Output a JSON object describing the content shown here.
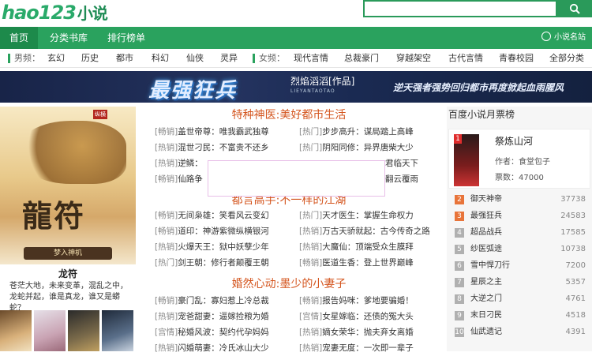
{
  "logo": {
    "text": "hao123",
    "sub": "小说"
  },
  "search": {
    "placeholder": "",
    "button_icon": "search-icon"
  },
  "nav": {
    "items": [
      "首页",
      "分类书库",
      "排行榜单"
    ],
    "brand": "小说名站"
  },
  "categories": {
    "male_label": "男频：",
    "male": [
      "玄幻",
      "历史",
      "都市",
      "科幻",
      "仙侠",
      "灵异"
    ],
    "female_label": "女频：",
    "female": [
      "现代言情",
      "总裁豪门",
      "穿越架空",
      "古代言情",
      "青春校园",
      "全部分类"
    ]
  },
  "banner": {
    "title": "最强狂兵",
    "author": "烈焰滔滔[作品]",
    "author_en": "LIEYANTAOTAO",
    "slogan": "逆天强者强势回归都市再度掀起血雨腥风"
  },
  "featured": {
    "cover_title": "龍符",
    "cover_subtitle": "梦入神机",
    "cover_publisher": "纵横",
    "title": "龙符",
    "desc": "苍茫大地，未来变革，混乱之中，龙蛇并起，谁是真龙，谁又是蟒蛇？"
  },
  "sections": [
    {
      "title": "特种神医:美好都市生活",
      "rows": [
        [
          "[畅销]",
          "盖世帝尊：唯我霸武独尊",
          "[热门]",
          "步步高升：谋局踏上高峰"
        ],
        [
          "[热销]",
          "混世刁民：不富贵不还乡",
          "[热门]",
          "阴阳同修：异界唐柴大少"
        ],
        [
          "[热销]",
          "逆鳞：",
          "",
          "君临天下"
        ],
        [
          "[畅销]",
          "仙路争",
          "",
          "翻云覆雨"
        ]
      ]
    },
    {
      "title": "都言高手:不一样的江湖",
      "rows": [
        [
          "[畅销]",
          "无间枭雄：笑看风云变幻",
          "[热门]",
          "天才医生：掌握生命权力"
        ],
        [
          "[畅销]",
          "道印：神游紫微纵横银河",
          "[热销]",
          "万古天骄就起：古今传奇之路"
        ],
        [
          "[热销]",
          "火爆天王：狱中妖孽少年",
          "[热销]",
          "大魔仙：顶端受众生膜拜"
        ],
        [
          "[热门]",
          "剑王朝：修行者颠覆王朝",
          "[畅销]",
          "医道生香：登上世界巅峰"
        ]
      ]
    },
    {
      "title": "婚然心动:墨少的小妻子",
      "rows": [
        [
          "[畅销]",
          "豪门乱：寡妇惹上冷总裁",
          "[畅销]",
          "报告妈咪：爹地要骗婚！"
        ],
        [
          "[热销]",
          "宠爸甜妻：逼嫁捡粮为婚",
          "[宫情]",
          "女星嫁临：还债的冤大头"
        ],
        [
          "[宫情]",
          "秘婚风波：契约代孕妈妈",
          "[热销]",
          "嫡女荣华：抛夫弃女离婚"
        ],
        [
          "[热销]",
          "闪婚萌妻：冷氏冰山大少",
          "[热销]",
          "宠妻无度：一次即一辈子"
        ]
      ]
    }
  ],
  "ranking": {
    "title": "百度小说月票榜",
    "top": {
      "num": "1",
      "name": "祭炼山河",
      "author": "作者：食堂包子",
      "votes": "票数：47000"
    },
    "items": [
      {
        "num": "2",
        "name": "御天神帝",
        "val": "37738"
      },
      {
        "num": "3",
        "name": "最强狂兵",
        "val": "24583"
      },
      {
        "num": "4",
        "name": "超品战兵",
        "val": "17585"
      },
      {
        "num": "5",
        "name": "纱医弧途",
        "val": "10738"
      },
      {
        "num": "6",
        "name": "雪中悍刀行",
        "val": "7200"
      },
      {
        "num": "7",
        "name": "星辰之主",
        "val": "5357"
      },
      {
        "num": "8",
        "name": "大逆之门",
        "val": "4761"
      },
      {
        "num": "9",
        "name": "末日刁民",
        "val": "4518"
      },
      {
        "num": "10",
        "name": "仙武遗记",
        "val": "4391"
      }
    ]
  },
  "colors": {
    "accent": "#2aa25e",
    "section_title": "#d4551e",
    "rank_hot": "#e8743a"
  }
}
